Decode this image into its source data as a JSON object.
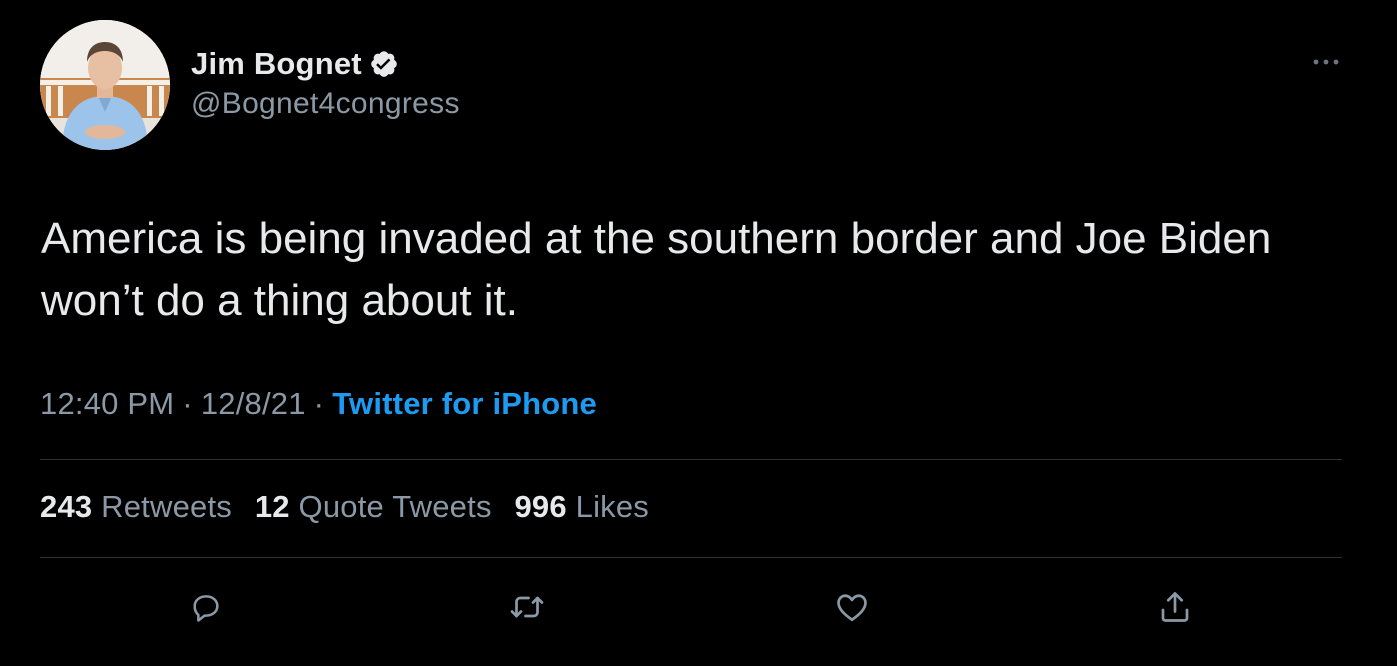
{
  "author": {
    "display_name": "Jim Bognet",
    "handle": "@Bognet4congress",
    "verified": true
  },
  "tweet": {
    "text": "America is being invaded at the southern border and Joe Biden won’t do a thing about it."
  },
  "meta": {
    "time": "12:40 PM",
    "separator": "·",
    "date": "12/8/21",
    "source": "Twitter for iPhone"
  },
  "stats": {
    "retweets_count": "243",
    "retweets_label": "Retweets",
    "quotes_count": "12",
    "quotes_label": "Quote Tweets",
    "likes_count": "996",
    "likes_label": "Likes"
  },
  "icons": {
    "more": "more-horizontal-icon",
    "verified": "verified-badge-icon",
    "reply": "reply-icon",
    "retweet": "retweet-icon",
    "like": "heart-icon",
    "share": "share-icon"
  },
  "colors": {
    "background": "#000000",
    "text_primary": "#e7e9ea",
    "text_secondary": "#8b98a5",
    "accent": "#1d9bf0",
    "divider": "#2f3336"
  }
}
